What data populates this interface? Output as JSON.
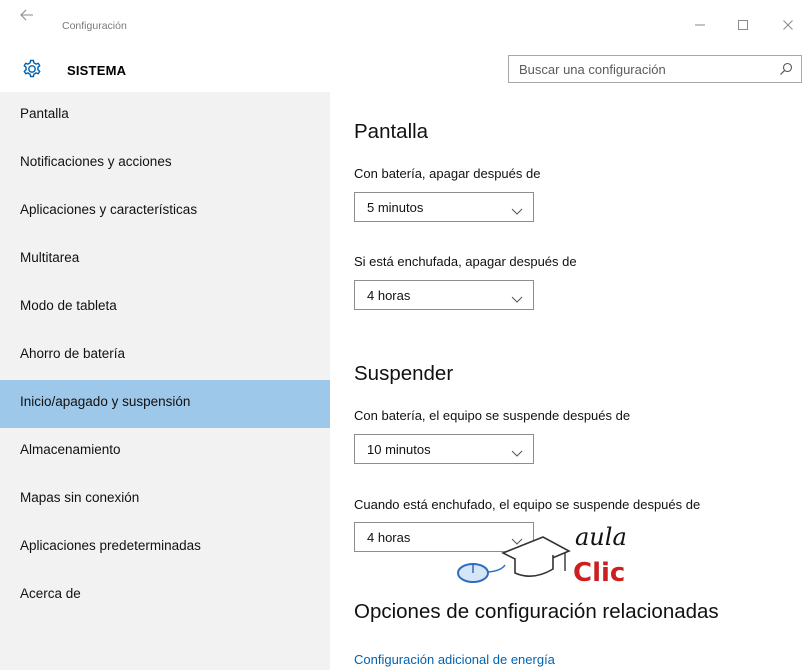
{
  "window": {
    "title": "Configuración",
    "back_icon": "back-arrow-icon",
    "controls": [
      "minimize-icon",
      "maximize-icon",
      "close-icon"
    ]
  },
  "header": {
    "icon": "gear-icon",
    "title": "SISTEMA",
    "search_placeholder": "Buscar una configuración",
    "search_icon": "search-icon"
  },
  "sidebar": {
    "items": [
      {
        "label": "Pantalla",
        "active": false
      },
      {
        "label": "Notificaciones y acciones",
        "active": false
      },
      {
        "label": "Aplicaciones y características",
        "active": false
      },
      {
        "label": "Multitarea",
        "active": false
      },
      {
        "label": "Modo de tableta",
        "active": false
      },
      {
        "label": "Ahorro de batería",
        "active": false
      },
      {
        "label": "Inicio/apagado y suspensión",
        "active": true
      },
      {
        "label": "Almacenamiento",
        "active": false
      },
      {
        "label": "Mapas sin conexión",
        "active": false
      },
      {
        "label": "Aplicaciones predeterminadas",
        "active": false
      },
      {
        "label": "Acerca de",
        "active": false
      }
    ]
  },
  "main": {
    "screen": {
      "heading": "Pantalla",
      "battery_label": "Con batería, apagar después de",
      "battery_value": "5 minutos",
      "plugged_label": "Si está enchufada, apagar después de",
      "plugged_value": "4 horas"
    },
    "sleep": {
      "heading": "Suspender",
      "battery_label": "Con batería, el equipo se suspende después de",
      "battery_value": "10 minutos",
      "plugged_label": "Cuando está enchufado, el equipo se suspende después de",
      "plugged_value": "4 horas"
    },
    "related": {
      "heading": "Opciones de configuración relacionadas",
      "link": "Configuración adicional de energía"
    }
  },
  "watermark": {
    "line1": "aula",
    "line2": "Clic"
  },
  "colors": {
    "active_nav": "#9ec8ea",
    "nav_bg": "#f2f2f2",
    "link": "#0063b1",
    "accent_icon": "#0063b1",
    "logo_red": "#cc1f1f"
  }
}
